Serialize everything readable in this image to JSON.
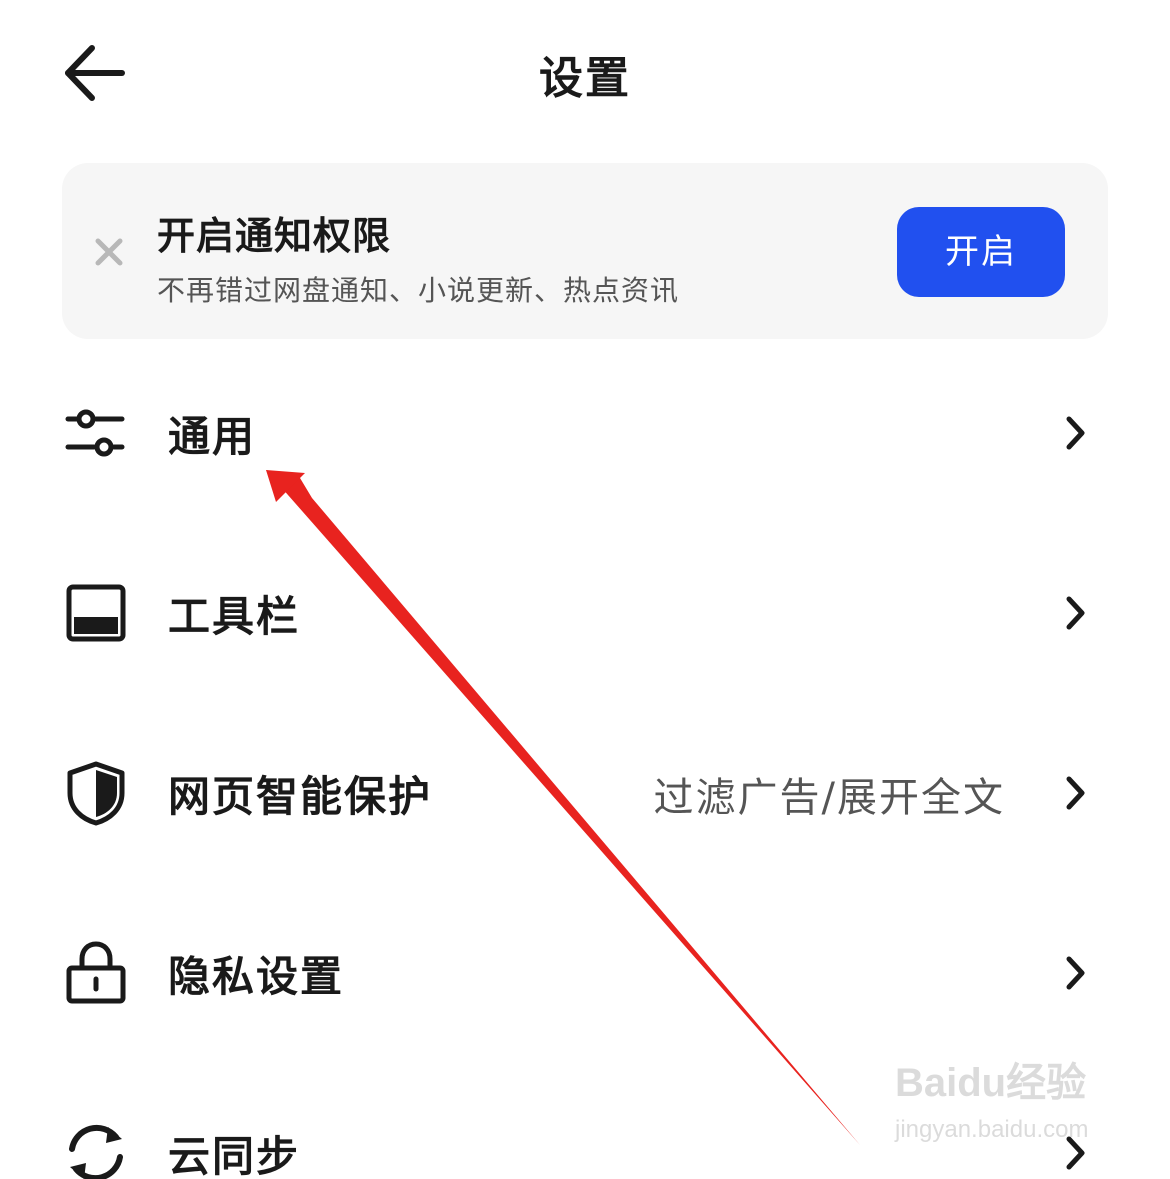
{
  "header": {
    "title": "设置",
    "back_icon": "arrow-left-icon"
  },
  "banner": {
    "title": "开启通知权限",
    "subtitle": "不再错过网盘通知、小说更新、热点资讯",
    "button_label": "开启",
    "close_icon": "close-icon",
    "button_color": "#2150ef",
    "background_color": "#f6f6f6"
  },
  "rows": [
    {
      "label": "通用",
      "value": "",
      "icon": "sliders-icon"
    },
    {
      "label": "工具栏",
      "value": "",
      "icon": "toolbar-icon"
    },
    {
      "label": "网页智能保护",
      "value": "过滤广告/展开全文",
      "icon": "shield-icon"
    },
    {
      "label": "隐私设置",
      "value": "",
      "icon": "lock-icon"
    },
    {
      "label": "云同步",
      "value": "",
      "icon": "sync-icon"
    }
  ],
  "annotation": {
    "type": "red-arrow",
    "color": "#e8231f",
    "points_to": "通用"
  },
  "watermark": {
    "main": "Baidu经验",
    "sub": "jingyan.baidu.com"
  }
}
